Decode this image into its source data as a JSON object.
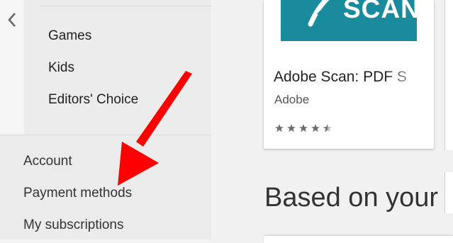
{
  "nav": {
    "categories": [
      "Games",
      "Kids",
      "Editors' Choice"
    ]
  },
  "account_menu": {
    "items": [
      "Account",
      "Payment methods",
      "My subscriptions"
    ]
  },
  "featured_app": {
    "banner_text": "SCAN",
    "title": "Adobe Scan: PDF S",
    "developer": "Adobe",
    "rating": 4.5,
    "banner_color": "#1a8b9c"
  },
  "section": {
    "heading": "Based on your"
  },
  "annotation": {
    "arrow_color": "#ff0000"
  }
}
